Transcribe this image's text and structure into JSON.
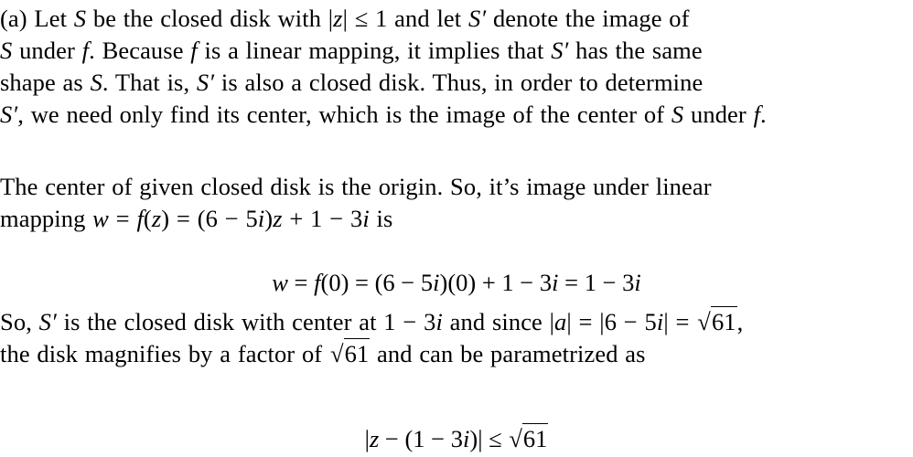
{
  "document": {
    "paragraph_1": {
      "label": "(a)",
      "lines": [
        "(a) Let S be the closed disk with |z| ≤ 1 and let S′ denote the image of",
        "S under f. Because f is a linear mapping, it implies that S′ has the same",
        "shape as S. That is, S′ is also a closed disk. Thus, in order to determine",
        "S′, we need only find its center, which is the image of the center of S under f."
      ]
    },
    "paragraph_2": {
      "lines": [
        "The center of given closed disk is the origin. So, it’s image under linear",
        "mapping w = f(z) = (6 − 5i)z + 1 − 3i is"
      ]
    },
    "equation_1": {
      "text": "w = f(0) = (6 − 5i)(0) + 1 − 3i = 1 − 3i"
    },
    "paragraph_3": {
      "lines": [
        "So, S′ is the closed disk with center at 1 − 3i and since |a| = |6 − 5i| = √61,",
        "the disk magnifies by a factor of √61 and can be parametrized as"
      ]
    },
    "equation_2": {
      "text": "|z − (1 − 3i)| ≤ √61"
    },
    "symbols": {
      "set": "S",
      "image_set": "S′",
      "func": "f",
      "var_z": "z",
      "var_w": "w",
      "var_a": "a",
      "var_i": "i",
      "sqrt_arg": "61",
      "sqrt_sign": "√"
    }
  }
}
